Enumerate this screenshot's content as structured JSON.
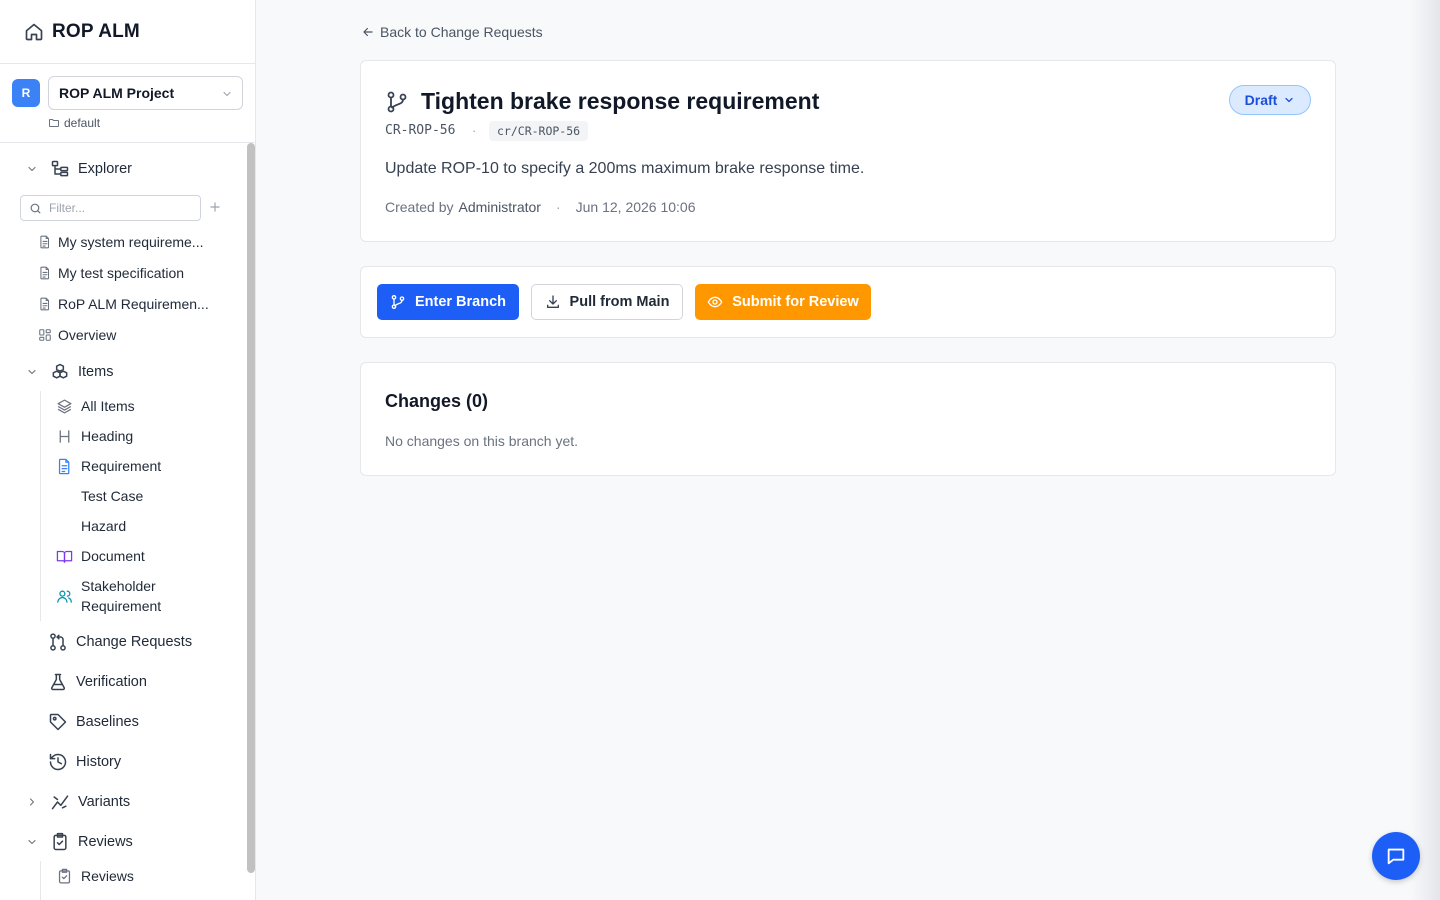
{
  "app": {
    "title": "ROP ALM"
  },
  "project": {
    "avatar": "R",
    "name": "ROP ALM Project",
    "workspace": "default"
  },
  "explorer": {
    "label": "Explorer",
    "filter_placeholder": "Filter...",
    "documents": [
      "My system requireme...",
      "My test specification",
      "RoP ALM Requiremen...",
      "Overview"
    ]
  },
  "items": {
    "label": "Items",
    "types": [
      "All Items",
      "Heading",
      "Requirement",
      "Test Case",
      "Hazard",
      "Document",
      "Stakeholder",
      "Requirement"
    ]
  },
  "nav": {
    "change_requests": "Change Requests",
    "verification": "Verification",
    "baselines": "Baselines",
    "history": "History",
    "variants": "Variants",
    "reviews": "Reviews",
    "reviews_sub": "Reviews"
  },
  "main": {
    "back_label": "Back to Change Requests",
    "cr": {
      "title": "Tighten brake response requirement",
      "id": "CR-ROP-56",
      "separator": "·",
      "branch": "cr/CR-ROP-56",
      "description": "Update ROP-10 to specify a 200ms maximum brake response time.",
      "created_by_label": "Created by",
      "author": "Administrator",
      "created_at": "Jun 12, 2026 10:06",
      "status": "Draft"
    },
    "actions": {
      "enter_branch": "Enter Branch",
      "pull_from_main": "Pull from Main",
      "submit_for_review": "Submit for Review"
    },
    "changes": {
      "title": "Changes (0)",
      "empty": "No changes on this branch yet."
    }
  },
  "colors": {
    "primary": "#1d5ff6",
    "warning": "#ff9800",
    "status_bg": "#dbeafe",
    "status_text": "#1d4ed8",
    "avatar": "#3b82f6"
  },
  "icons": {
    "brand": "home-icon",
    "explorer": "tree-icon",
    "items": "boxes-icon",
    "change_requests": "git-pull-request-icon",
    "verification": "flask-icon",
    "baselines": "tag-icon",
    "history": "history-icon",
    "variants": "variants-icon",
    "reviews": "clipboard-check-icon",
    "chat": "chat-icon"
  }
}
